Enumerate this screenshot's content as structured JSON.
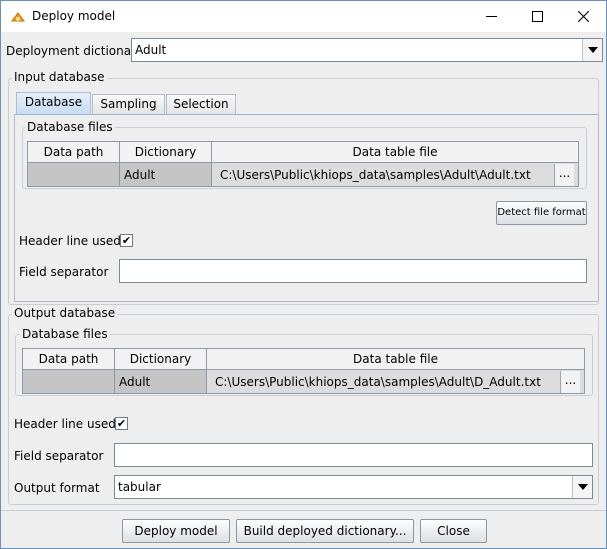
{
  "window": {
    "title": "Deploy model",
    "icon": "khiops-app-icon",
    "controls": [
      "minimize-icon",
      "maximize-icon",
      "close-icon"
    ]
  },
  "deployment": {
    "label": "Deployment dictionary",
    "value": "Adult"
  },
  "input": {
    "group_title": "Input database",
    "tabs": [
      "Database",
      "Sampling",
      "Selection"
    ],
    "active_tab": "Database",
    "files_title": "Database files",
    "columns": [
      "Data path",
      "Dictionary",
      "Data table file"
    ],
    "rows": [
      {
        "data_path": "",
        "dictionary": "Adult",
        "file": "C:\\Users\\Public\\khiops_data\\samples\\Adult\\Adult.txt",
        "browse": "..."
      }
    ],
    "detect_button": "Detect file format",
    "header_label": "Header line used",
    "header_checked": true,
    "separator_label": "Field separator",
    "separator_value": ""
  },
  "output": {
    "group_title": "Output database",
    "files_title": "Database files",
    "columns": [
      "Data path",
      "Dictionary",
      "Data table file"
    ],
    "rows": [
      {
        "data_path": "",
        "dictionary": "Adult",
        "file": "C:\\Users\\Public\\khiops_data\\samples\\Adult\\D_Adult.txt",
        "browse": "..."
      }
    ],
    "header_label": "Header line used",
    "header_checked": true,
    "separator_label": "Field separator",
    "separator_value": "",
    "format_label": "Output format",
    "format_value": "tabular"
  },
  "buttons": {
    "deploy": "Deploy model",
    "build": "Build deployed dictionary...",
    "close": "Close"
  },
  "check_glyph": "✔"
}
